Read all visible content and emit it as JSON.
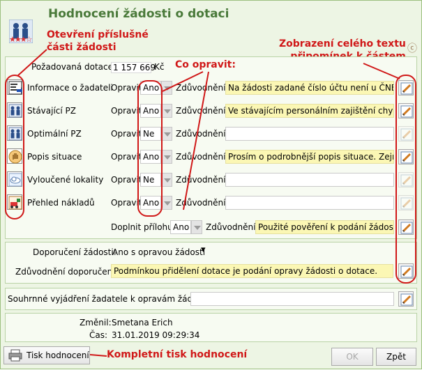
{
  "window": {
    "title": "Hodnocení žádosti o dotaci"
  },
  "request": {
    "label": "Požadovaná dotace:",
    "amount": "1 157 669",
    "currency": "Kč"
  },
  "sections": [
    {
      "name": "Informace o žadateli",
      "opravit": "Opravit",
      "value": "Ano",
      "zduv": "Zdůvodnění:",
      "text": "Na žádosti zadané číslo účtu není u ČNB.",
      "edit_enabled": true,
      "icon": "applicant-info-icon"
    },
    {
      "name": "Stávající PZ",
      "opravit": "Opravit",
      "value": "Ano",
      "zduv": "Zdůvodnění:",
      "text": "Ve stávajícím personálním zajištění chybí:",
      "edit_enabled": true,
      "icon": "people-icon"
    },
    {
      "name": "Optimální PZ",
      "opravit": "Opravit",
      "value": "Ne",
      "zduv": "Zdůvodnění:",
      "text": "",
      "edit_enabled": false,
      "icon": "people-icon"
    },
    {
      "name": "Popis situace",
      "opravit": "Opravit",
      "value": "Ano",
      "zduv": "Zdůvodnění:",
      "text": "Prosím o podrobnější popis situace. Zejmé",
      "edit_enabled": true,
      "icon": "hand-icon"
    },
    {
      "name": "Vyloučené lokality",
      "opravit": "Opravit",
      "value": "Ne",
      "zduv": "Zdůvodnění:",
      "text": "",
      "edit_enabled": false,
      "icon": "cloud-icon"
    },
    {
      "name": "Přehled nákladů",
      "opravit": "Opravit",
      "value": "Ano",
      "zduv": "Zdůvodnění:",
      "text": "",
      "edit_enabled": false,
      "icon": "costs-icon"
    }
  ],
  "attachment": {
    "label": "Doplnit přílohu:",
    "value": "Ano",
    "zduv": "Zdůvodnění:",
    "text": "Použité pověření k podání žádosti je"
  },
  "recommendation": {
    "label": "Doporučení žádosti:",
    "value": "Ano s opravou žádosti",
    "reason_label": "Zdůvodnění doporučení:",
    "reason": "Podmínkou přidělení dotace je podání opravy žádosti o dotace."
  },
  "summary": {
    "label": "Souhrnné vyjádření žadatele k opravám žádosti:",
    "value": ""
  },
  "changed": {
    "by_label": "Změnil:",
    "by": "Smetana Erich",
    "time_label": "Čas:",
    "time": "31.01.2019 09:29:34"
  },
  "buttons": {
    "print": "Tisk hodnocení",
    "ok": "OK",
    "back": "Zpět"
  },
  "annotations": {
    "open_part": "Otevření příslušné\nčásti žádosti",
    "fix": "Co opravit:",
    "show_text": "Zobrazení celého textu\npřipomínek k částem",
    "print_all": "Kompletní tisk hodnocení"
  },
  "colors": {
    "title": "#4a7a3a",
    "annotation": "#d01818",
    "highlight": "#fbf7b4",
    "window_bg": "#edf5e4"
  }
}
